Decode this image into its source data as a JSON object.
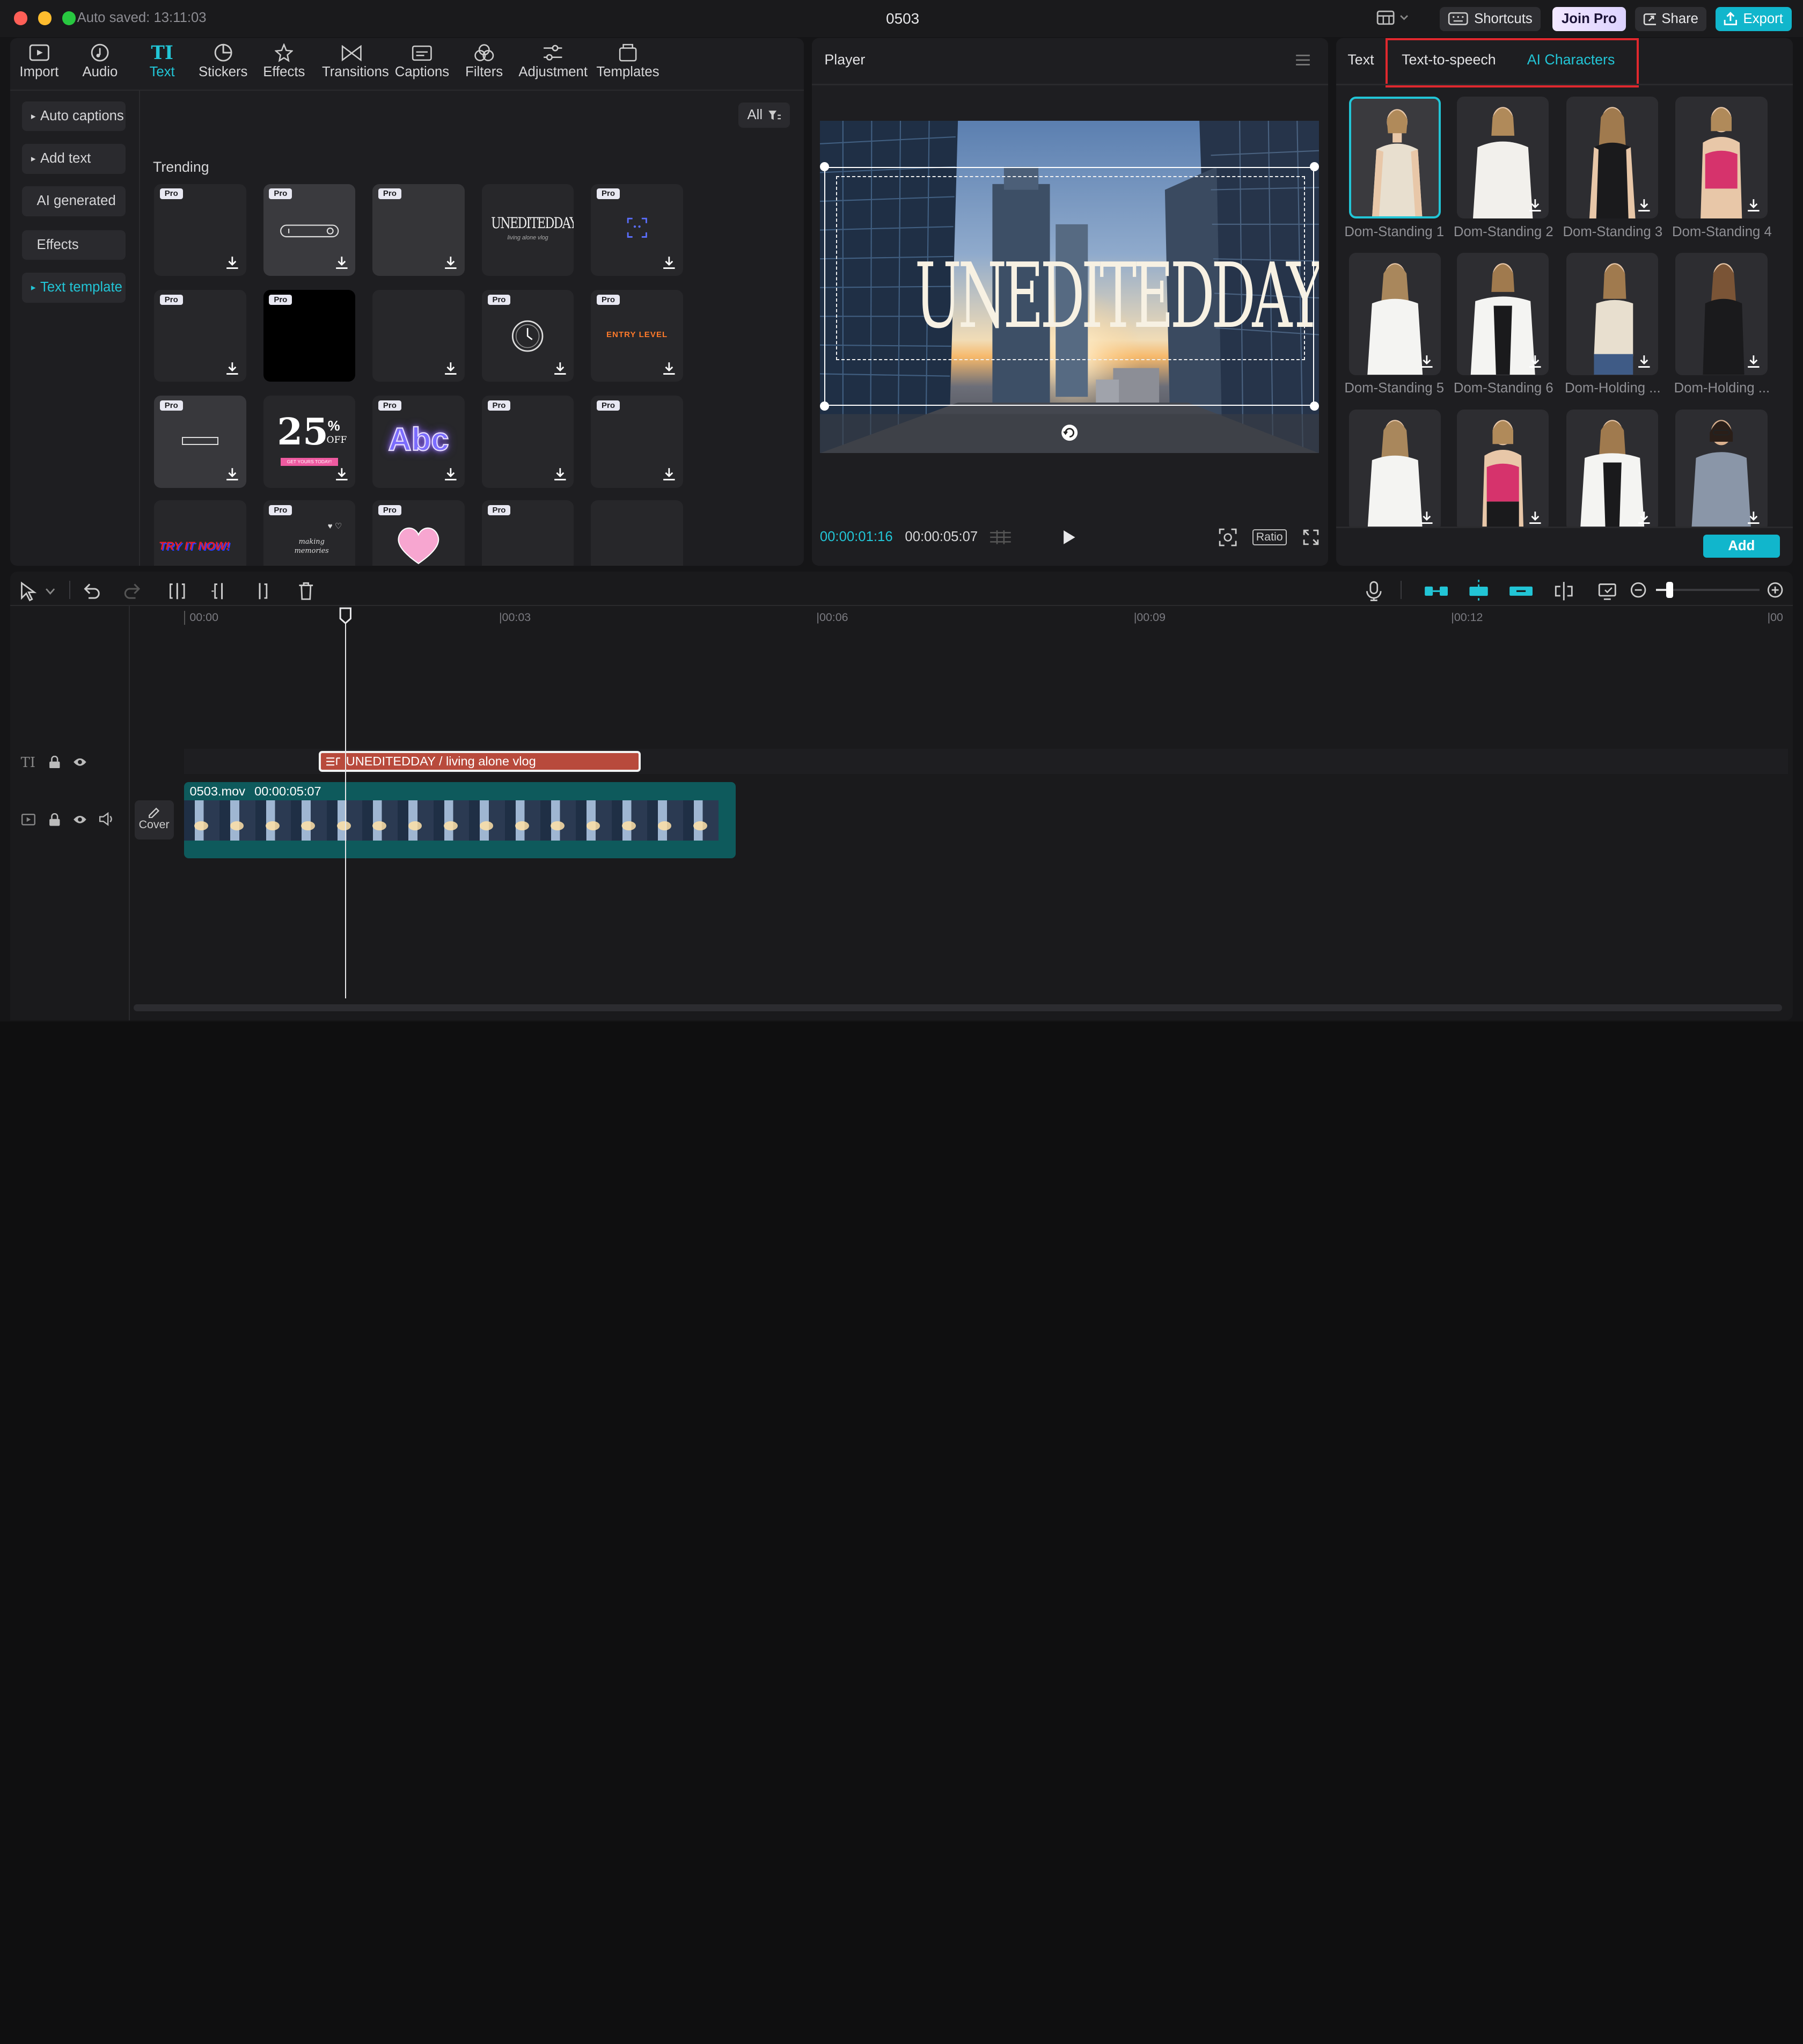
{
  "titlebar": {
    "autosave": "Auto saved: 13:11:03",
    "project_name": "0503",
    "shortcuts_label": "Shortcuts",
    "join_pro_label": "Join Pro",
    "share_label": "Share",
    "export_label": "Export"
  },
  "toolbar": {
    "items": [
      {
        "label": "Import",
        "icon": "import-icon"
      },
      {
        "label": "Audio",
        "icon": "audio-icon"
      },
      {
        "label": "Text",
        "icon": "text-icon"
      },
      {
        "label": "Stickers",
        "icon": "sticker-icon"
      },
      {
        "label": "Effects",
        "icon": "effects-icon"
      },
      {
        "label": "Transitions",
        "icon": "transitions-icon"
      },
      {
        "label": "Captions",
        "icon": "captions-icon"
      },
      {
        "label": "Filters",
        "icon": "filters-icon"
      },
      {
        "label": "Adjustment",
        "icon": "adjustment-icon"
      },
      {
        "label": "Templates",
        "icon": "templates-icon"
      }
    ],
    "active": "Text"
  },
  "sidebar": {
    "items": [
      {
        "label": "Auto captions"
      },
      {
        "label": "Add text"
      },
      {
        "label": "AI generated"
      },
      {
        "label": "Effects"
      },
      {
        "label": "Text template"
      }
    ]
  },
  "library": {
    "filter_label": "All",
    "section_title": "Trending",
    "pro_badge": "Pro",
    "card_text": {
      "unedited_title": "UNEDITEDDAY",
      "unedited_sub": "living alone vlog",
      "entry_level": "ENTRY LEVEL",
      "percent_big": "25",
      "percent_off": "OFF",
      "get_yours": "GET YOURS TODAY!",
      "abc": "Abc",
      "try_it_now": "TRY IT NOW!",
      "making_memories": "making memories"
    }
  },
  "player": {
    "title": "Player",
    "overlay_text": "UNEDITEDDAY",
    "current_time": "00:00:01:16",
    "total_time": "00:00:05:07",
    "ratio_label": "Ratio"
  },
  "right_panel": {
    "tabs": [
      {
        "label": "Text"
      },
      {
        "label": "Text-to-speech"
      },
      {
        "label": "AI Characters"
      }
    ],
    "active_tab": "AI Characters",
    "characters": [
      {
        "label": "Dom-Standing 1"
      },
      {
        "label": "Dom-Standing 2"
      },
      {
        "label": "Dom-Standing 3"
      },
      {
        "label": "Dom-Standing 4"
      },
      {
        "label": "Dom-Standing 5"
      },
      {
        "label": "Dom-Standing 6"
      },
      {
        "label": "Dom-Holding ..."
      },
      {
        "label": "Dom-Holding ..."
      }
    ],
    "add_label": "Add"
  },
  "timeline": {
    "ticks": [
      "00:00",
      "|00:03",
      "|00:06",
      "|00:09",
      "|00:12",
      "|00"
    ],
    "text_clip_label": "UNEDITEDDAY / living alone vlog",
    "video_clip_name": "0503.mov",
    "video_clip_duration": "00:00:05:07",
    "cover_label": "Cover"
  },
  "colors": {
    "accent": "#22c5d6",
    "highlight_border": "#e0282e",
    "text_clip": "#b84a3c",
    "video_clip": "#0e5a5c"
  }
}
